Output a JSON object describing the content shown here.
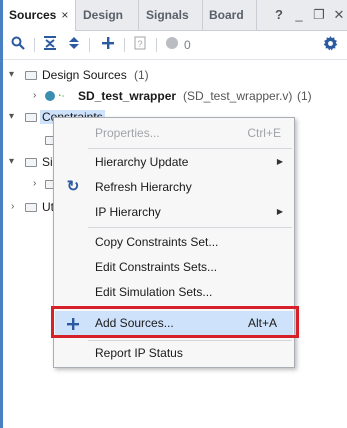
{
  "tabs": [
    {
      "label": "Sources",
      "active": true,
      "close": "×"
    },
    {
      "label": "Design"
    },
    {
      "label": "Signals"
    },
    {
      "label": "Board"
    }
  ],
  "tab_icons": {
    "help": "?",
    "minimize": "_",
    "restore": "❐",
    "close": "✕"
  },
  "toolbar": {
    "error_count": "0"
  },
  "tree": {
    "design_sources": {
      "label": "Design Sources",
      "count": "(1)"
    },
    "top_module": {
      "name": "SD_test_wrapper",
      "file": "(SD_test_wrapper.v)",
      "count": "(1)"
    },
    "constraints": {
      "label": "Constraints"
    },
    "simulation_partial": {
      "label": "Si"
    },
    "utility_partial": {
      "label": "Ut"
    }
  },
  "context_menu": {
    "items": [
      {
        "label": "Properties...",
        "shortcut": "Ctrl+E",
        "disabled": true
      },
      {
        "label": "Hierarchy Update",
        "submenu": true
      },
      {
        "label": "Refresh Hierarchy",
        "icon": "refresh-icon"
      },
      {
        "label": "IP Hierarchy",
        "submenu": true
      },
      {
        "label": "Copy Constraints Set..."
      },
      {
        "label": "Edit Constraints Sets..."
      },
      {
        "label": "Edit Simulation Sets..."
      },
      {
        "label": "Add Sources...",
        "shortcut": "Alt+A",
        "icon": "plus-icon",
        "highlighted": true
      },
      {
        "label": "Report IP Status"
      }
    ]
  },
  "colors": {
    "accent": "#2c5aa0",
    "highlight": "#cfe2fb",
    "annotation": "#d7212a"
  }
}
